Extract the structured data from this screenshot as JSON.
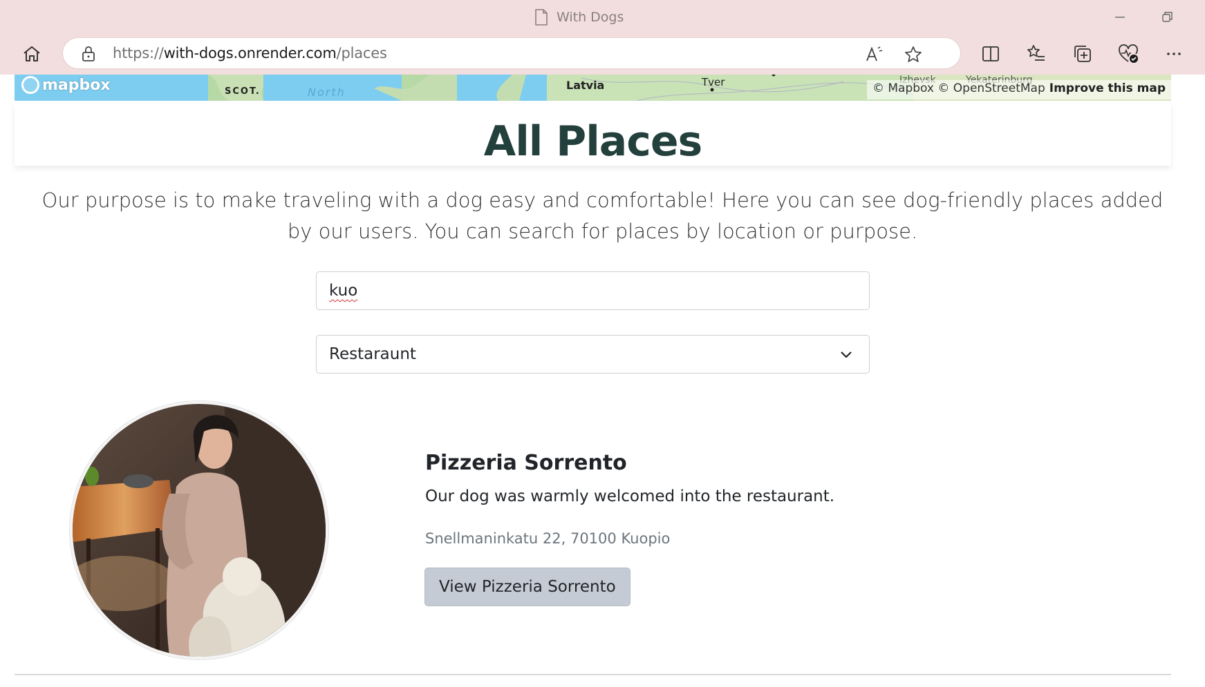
{
  "browser": {
    "tab_title": "With Dogs",
    "url_prefix": "https://",
    "url_host": "with-dogs.onrender.com",
    "url_path": "/places",
    "icons": [
      "page-icon",
      "minimize-icon",
      "restore-icon",
      "home-icon",
      "lock-icon",
      "read-aloud-icon",
      "favorite-star-icon",
      "split-screen-icon",
      "favorites-list-icon",
      "collections-icon",
      "browser-essentials-icon",
      "more-icon"
    ]
  },
  "map": {
    "logo_text": "mapbox",
    "labels": {
      "scotland": "SCOT.",
      "north": "North",
      "latvia": "Latvia",
      "tver": "Tver",
      "izhevsk": "Izhevsk",
      "yekaterinburg": "Yekaterinburg"
    },
    "attribution": "© Mapbox © OpenStreetMap",
    "improve_link": "Improve this map"
  },
  "header": {
    "title": "All Places"
  },
  "intro": {
    "text": "Our purpose is to make traveling with a dog easy and comfortable! Here you can see dog-friendly places added by our users. You can search for places by location or purpose."
  },
  "filters": {
    "search_value": "kuo",
    "purpose_selected": "Restaraunt"
  },
  "places": [
    {
      "name": "Pizzeria Sorrento",
      "description": "Our dog was warmly welcomed into the restaurant.",
      "address": "Snellmaninkatu 22, 70100 Kuopio",
      "button_label": "View Pizzeria Sorrento"
    }
  ],
  "colors": {
    "chrome": "#f2dede",
    "title": "#23403c",
    "button": "#c4cbd4",
    "map_water": "#7dcdf0",
    "map_land": "#b7d9a6"
  }
}
